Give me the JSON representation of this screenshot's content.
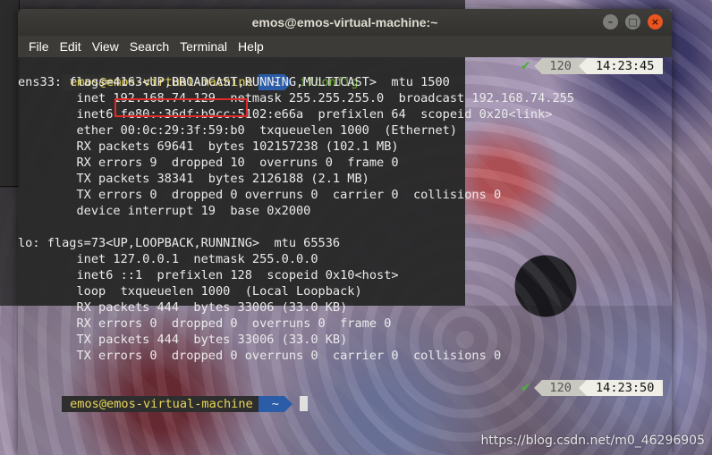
{
  "window": {
    "title": "emos@emos-virtual-machine:~",
    "controls": {
      "minimize": "–",
      "maximize": "□",
      "close": "×"
    }
  },
  "menu": [
    "File",
    "Edit",
    "View",
    "Search",
    "Terminal",
    "Help"
  ],
  "prompt1": {
    "user": "emos@emos-virtual-machine",
    "dir": "~",
    "command": "ifconfig",
    "status": "✔",
    "history": "120",
    "time": "14:23:45"
  },
  "output": [
    "ens33: flags=4163<UP,BROADCAST,RUNNING,MULTICAST>  mtu 1500",
    "        inet 192.168.74.129  netmask 255.255.255.0  broadcast 192.168.74.255",
    "        inet6 fe80::36df:b9cc:5102:e66a  prefixlen 64  scopeid 0x20<link>",
    "        ether 00:0c:29:3f:59:b0  txqueuelen 1000  (Ethernet)",
    "        RX packets 69641  bytes 102157238 (102.1 MB)",
    "        RX errors 9  dropped 10  overruns 0  frame 0",
    "        TX packets 38341  bytes 2126188 (2.1 MB)",
    "        TX errors 0  dropped 0 overruns 0  carrier 0  collisions 0",
    "        device interrupt 19  base 0x2000",
    "",
    "lo: flags=73<UP,LOOPBACK,RUNNING>  mtu 65536",
    "        inet 127.0.0.1  netmask 255.0.0.0",
    "        inet6 ::1  prefixlen 128  scopeid 0x10<host>",
    "        loop  txqueuelen 1000  (Local Loopback)",
    "        RX packets 444  bytes 33006 (33.0 KB)",
    "        RX errors 0  dropped 0  overruns 0  frame 0",
    "        TX packets 444  bytes 33006 (33.0 KB)",
    "        TX errors 0  dropped 0 overruns 0  carrier 0  collisions 0",
    ""
  ],
  "highlighted_ip": "192.168.74.129",
  "prompt2": {
    "user": "emos@emos-virtual-machine",
    "dir": "~",
    "status": "✔",
    "history": "120",
    "time": "14:23:50"
  },
  "watermark": "https://blog.csdn.net/m0_46296905",
  "colors": {
    "prompt_user_fg": "#e8d75a",
    "prompt_dir_bg": "#2a5ca8",
    "command": "#74b33a",
    "highlight": "#e02a2a",
    "close_button": "#e95420"
  }
}
